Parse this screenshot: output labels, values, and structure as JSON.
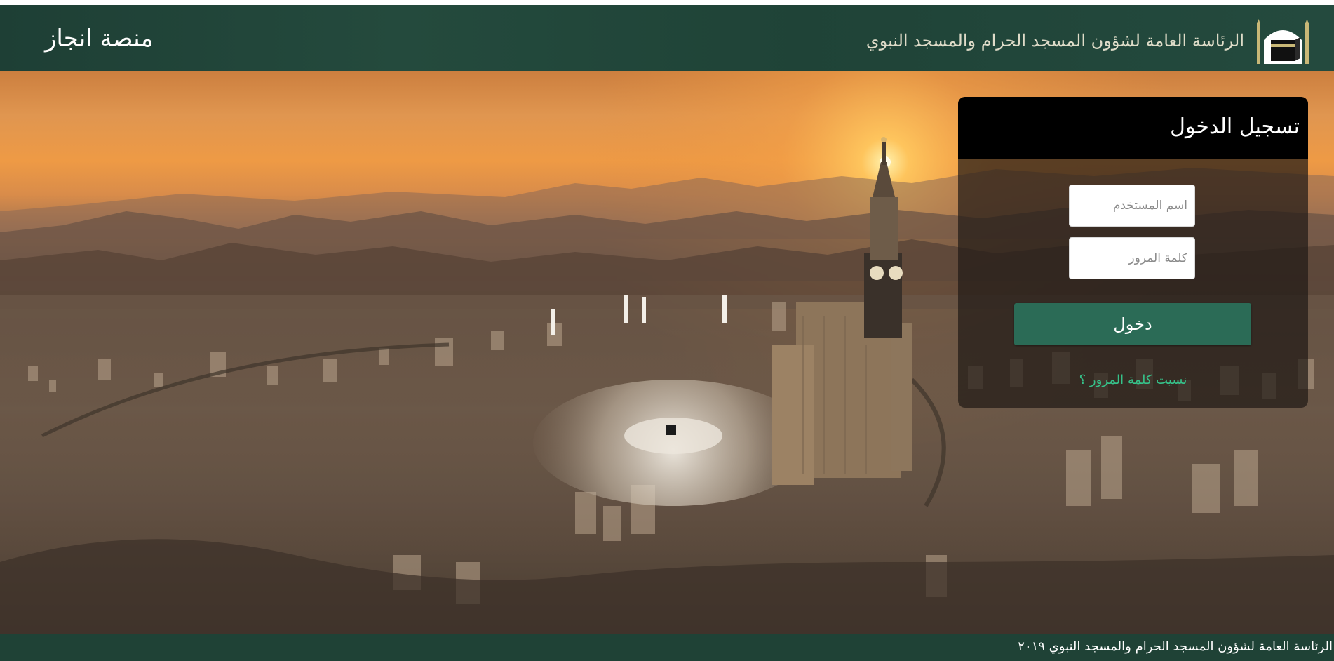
{
  "header": {
    "brand_title": "منصة انجاز",
    "org_name": "الرئاسة العامة لشؤون المسجد الحرام والمسجد النبوي",
    "colors": {
      "bar": "#244a3d",
      "text": "#ffffff"
    }
  },
  "hero": {
    "image_icon": "makkah-clock-tower-aerial-photo"
  },
  "login": {
    "title": "تسجيل الدخول",
    "username_placeholder": "اسم المستخدم",
    "username_value": "",
    "password_placeholder": "كلمة المرور",
    "password_value": "",
    "submit_label": "دخول",
    "forgot_password_label": "نسيت كلمة المرور ؟",
    "colors": {
      "button": "#2b6b56",
      "link": "#36c28a",
      "header": "#000000"
    }
  },
  "footer": {
    "copyright": "الرئاسة العامة لشؤون المسجد الحرام والمسجد النبوي ٢٠١٩"
  }
}
